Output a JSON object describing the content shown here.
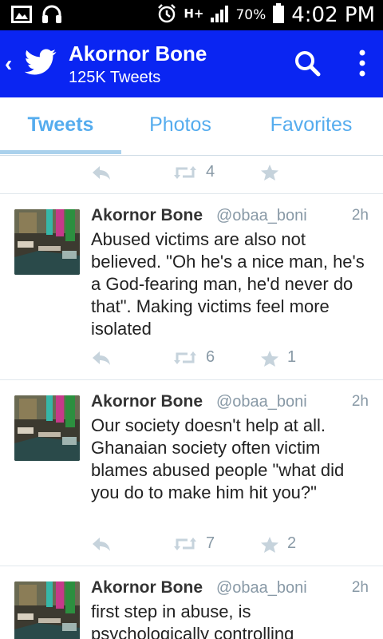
{
  "status_bar": {
    "battery_percent": "70%",
    "time": "4:02 PM",
    "network": "H+",
    "icons": [
      "image-icon",
      "headphones-icon",
      "alarm-icon",
      "network-icon",
      "signal-icon",
      "battery-icon"
    ]
  },
  "header": {
    "title": "Akornor Bone",
    "subtitle": "125K Tweets",
    "brand_color": "#0a25f2"
  },
  "tabs": [
    {
      "label": "Tweets",
      "selected": true
    },
    {
      "label": "Photos",
      "selected": false
    },
    {
      "label": "Favorites",
      "selected": false
    }
  ],
  "previous_tweet_actions": {
    "retweets": "4"
  },
  "tweets": [
    {
      "name": "Akornor Bone",
      "handle": "@obaa_boni",
      "time": "2h",
      "text": "Abused victims are also not believed. \"Oh he's a nice man, he's a God-fearing man, he'd never do that\". Making victims feel more isolated",
      "retweets": "6",
      "favorites": "1"
    },
    {
      "name": "Akornor Bone",
      "handle": "@obaa_boni",
      "time": "2h",
      "text": "Our society doesn't help at all. Ghanaian society often victim blames abused people \"what did you do to make him hit you?\"",
      "retweets": "7",
      "favorites": "2"
    },
    {
      "name": "Akornor Bone",
      "handle": "@obaa_boni",
      "time": "2h",
      "text": "first step in abuse, is psychologically controlling"
    }
  ]
}
